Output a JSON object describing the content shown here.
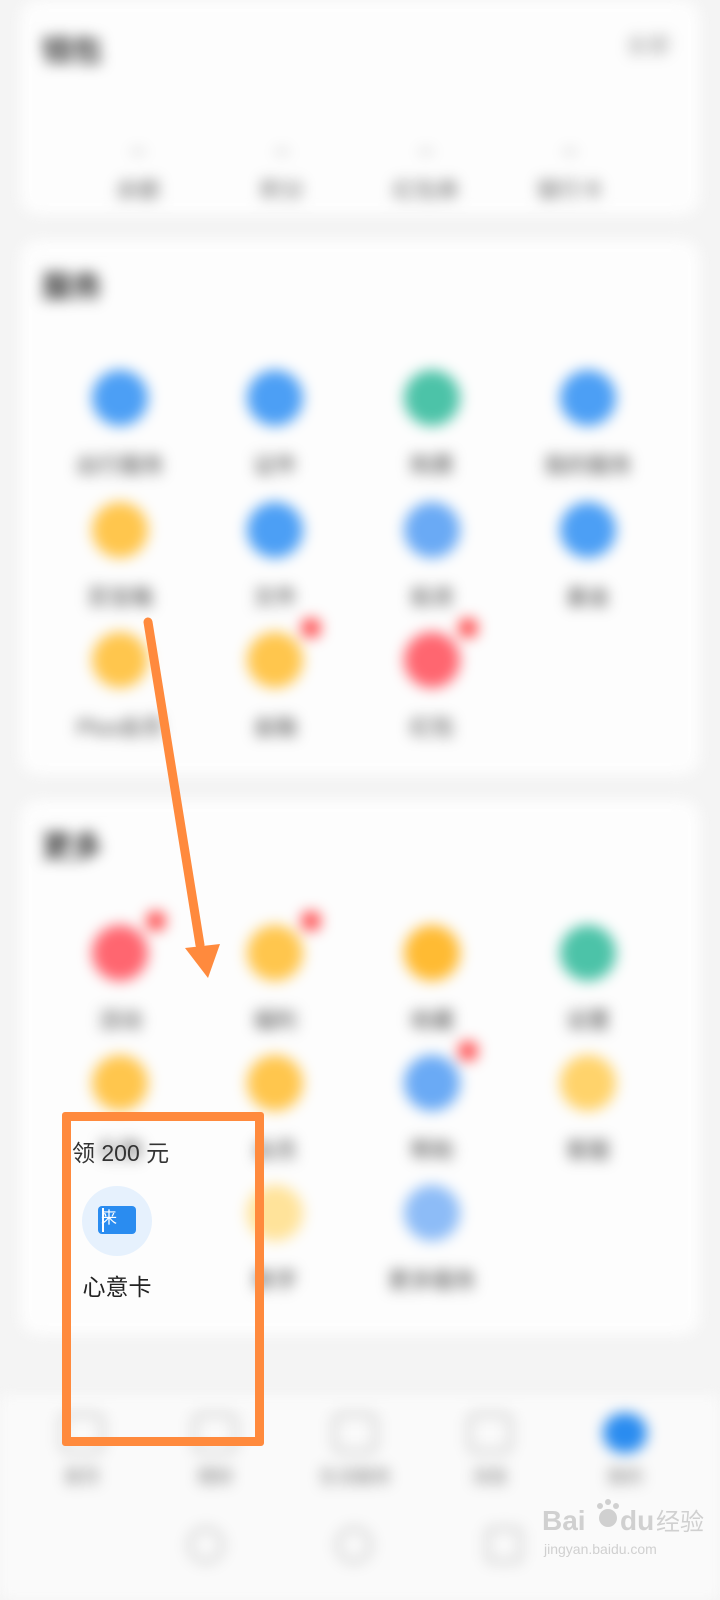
{
  "blurred": {
    "top_card": {
      "title": "钱包",
      "link": "全部",
      "stats": [
        "余额",
        "积分",
        "红包券",
        "银行卡"
      ]
    },
    "services_card": {
      "title": "服务",
      "items": [
        "出行服务",
        "证件",
        "购票",
        "我的服务",
        "百宝箱",
        "文件",
        "投资",
        "基金",
        "Plus会员",
        "金融",
        "红包"
      ]
    },
    "more_card": {
      "title": "更多",
      "items": [
        "活动",
        "福利",
        "收藏",
        "设置",
        "礼物",
        "会员",
        "帮助",
        "客服",
        "心意卡",
        "数字",
        "更多服务"
      ]
    },
    "bottom_nav": [
      "首页",
      "理财",
      "生活服务",
      "消息",
      "我的"
    ]
  },
  "promo": {
    "label": "领 200 元"
  },
  "xinyi": {
    "label": "心意卡",
    "icon": "card-icon",
    "glyph": "来"
  },
  "colors": {
    "highlight": "#ff8a3d",
    "icon_blue": "#2a8cf0"
  }
}
